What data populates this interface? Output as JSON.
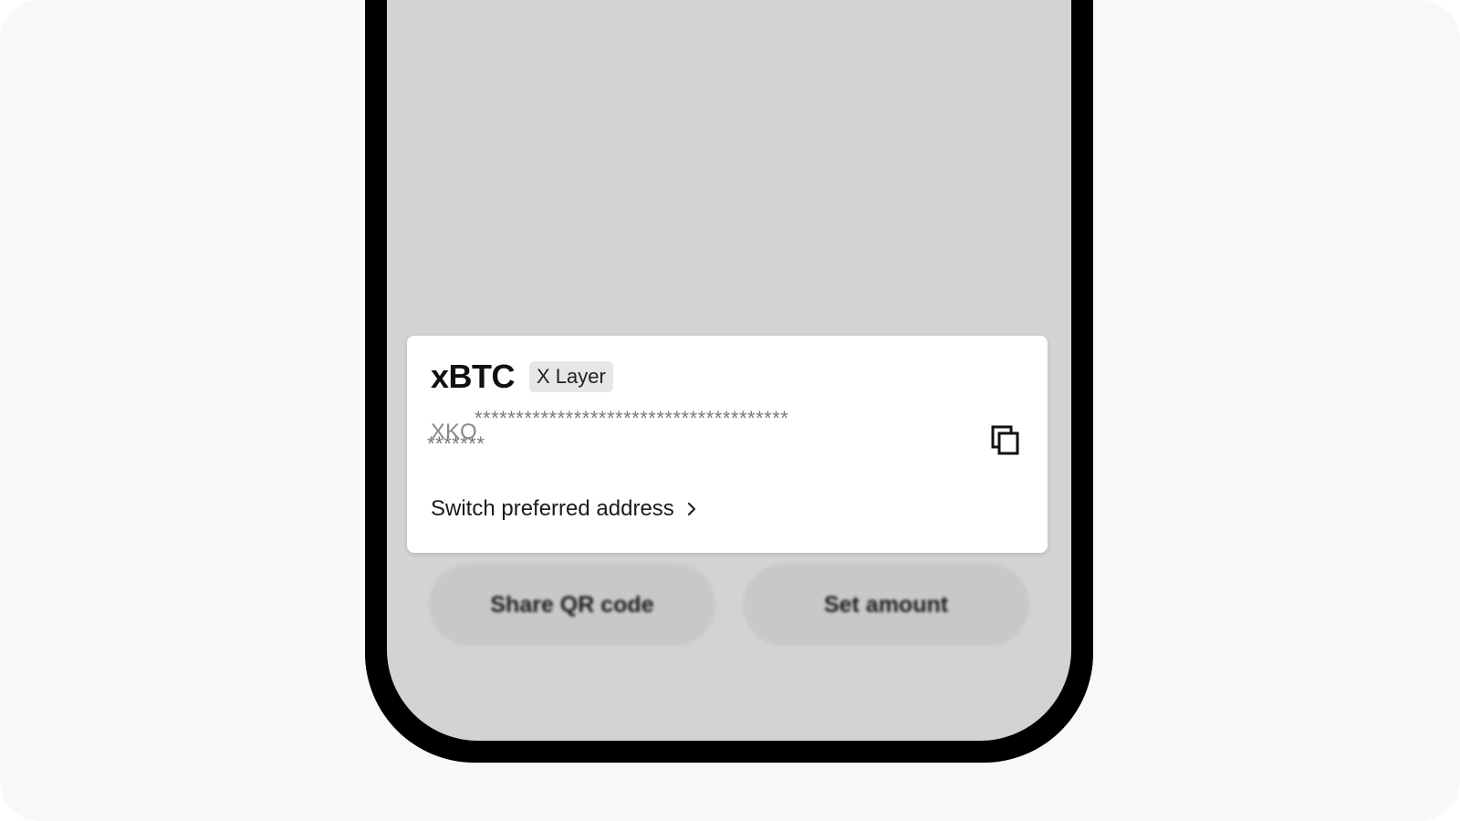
{
  "receive_card": {
    "token_symbol": "xBTC",
    "network_badge": "X Layer",
    "address_prefix": "XKO",
    "address_mask_line1": "**************************************",
    "address_mask_line2": "*******",
    "switch_address_label": "Switch preferred address"
  },
  "actions": {
    "share_qr_label": "Share QR code",
    "set_amount_label": "Set amount"
  },
  "icons": {
    "copy": "copy-icon",
    "chevron": "chevron-right-icon"
  },
  "colors": {
    "screen_dim": "#d3d3d3",
    "badge_bg": "#e6e6e6",
    "phone_frame": "#000000"
  }
}
